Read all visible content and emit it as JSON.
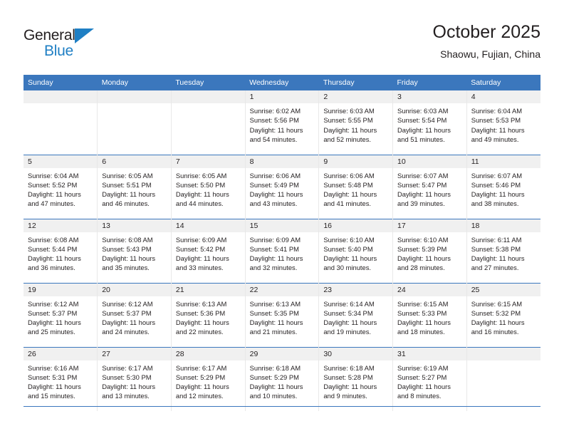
{
  "brand": {
    "name_part1": "General",
    "name_part2": "Blue",
    "triangle_color": "#1f7fc4",
    "text_color": "#231f20"
  },
  "header": {
    "title": "October 2025",
    "subtitle": "Shaowu, Fujian, China"
  },
  "theme": {
    "header_bg": "#3b77bd",
    "header_text": "#ffffff",
    "daynum_bg": "#f0f0f0",
    "cell_divider": "#e8e8e8",
    "row_divider": "#3b77bd",
    "body_text": "#231f20"
  },
  "weekday_headers": [
    "Sunday",
    "Monday",
    "Tuesday",
    "Wednesday",
    "Thursday",
    "Friday",
    "Saturday"
  ],
  "labels": {
    "sunrise_prefix": "Sunrise:",
    "sunset_prefix": "Sunset:",
    "daylight_prefix": "Daylight:"
  },
  "weeks": [
    [
      {
        "day": "",
        "line1": "",
        "line2": "",
        "line3": "",
        "line4": "",
        "empty": true
      },
      {
        "day": "",
        "line1": "",
        "line2": "",
        "line3": "",
        "line4": "",
        "empty": true
      },
      {
        "day": "",
        "line1": "",
        "line2": "",
        "line3": "",
        "line4": "",
        "empty": true
      },
      {
        "day": "1",
        "line1": "Sunrise: 6:02 AM",
        "line2": "Sunset: 5:56 PM",
        "line3": "Daylight: 11 hours",
        "line4": "and 54 minutes.",
        "empty": false
      },
      {
        "day": "2",
        "line1": "Sunrise: 6:03 AM",
        "line2": "Sunset: 5:55 PM",
        "line3": "Daylight: 11 hours",
        "line4": "and 52 minutes.",
        "empty": false
      },
      {
        "day": "3",
        "line1": "Sunrise: 6:03 AM",
        "line2": "Sunset: 5:54 PM",
        "line3": "Daylight: 11 hours",
        "line4": "and 51 minutes.",
        "empty": false
      },
      {
        "day": "4",
        "line1": "Sunrise: 6:04 AM",
        "line2": "Sunset: 5:53 PM",
        "line3": "Daylight: 11 hours",
        "line4": "and 49 minutes.",
        "empty": false
      }
    ],
    [
      {
        "day": "5",
        "line1": "Sunrise: 6:04 AM",
        "line2": "Sunset: 5:52 PM",
        "line3": "Daylight: 11 hours",
        "line4": "and 47 minutes.",
        "empty": false
      },
      {
        "day": "6",
        "line1": "Sunrise: 6:05 AM",
        "line2": "Sunset: 5:51 PM",
        "line3": "Daylight: 11 hours",
        "line4": "and 46 minutes.",
        "empty": false
      },
      {
        "day": "7",
        "line1": "Sunrise: 6:05 AM",
        "line2": "Sunset: 5:50 PM",
        "line3": "Daylight: 11 hours",
        "line4": "and 44 minutes.",
        "empty": false
      },
      {
        "day": "8",
        "line1": "Sunrise: 6:06 AM",
        "line2": "Sunset: 5:49 PM",
        "line3": "Daylight: 11 hours",
        "line4": "and 43 minutes.",
        "empty": false
      },
      {
        "day": "9",
        "line1": "Sunrise: 6:06 AM",
        "line2": "Sunset: 5:48 PM",
        "line3": "Daylight: 11 hours",
        "line4": "and 41 minutes.",
        "empty": false
      },
      {
        "day": "10",
        "line1": "Sunrise: 6:07 AM",
        "line2": "Sunset: 5:47 PM",
        "line3": "Daylight: 11 hours",
        "line4": "and 39 minutes.",
        "empty": false
      },
      {
        "day": "11",
        "line1": "Sunrise: 6:07 AM",
        "line2": "Sunset: 5:46 PM",
        "line3": "Daylight: 11 hours",
        "line4": "and 38 minutes.",
        "empty": false
      }
    ],
    [
      {
        "day": "12",
        "line1": "Sunrise: 6:08 AM",
        "line2": "Sunset: 5:44 PM",
        "line3": "Daylight: 11 hours",
        "line4": "and 36 minutes.",
        "empty": false
      },
      {
        "day": "13",
        "line1": "Sunrise: 6:08 AM",
        "line2": "Sunset: 5:43 PM",
        "line3": "Daylight: 11 hours",
        "line4": "and 35 minutes.",
        "empty": false
      },
      {
        "day": "14",
        "line1": "Sunrise: 6:09 AM",
        "line2": "Sunset: 5:42 PM",
        "line3": "Daylight: 11 hours",
        "line4": "and 33 minutes.",
        "empty": false
      },
      {
        "day": "15",
        "line1": "Sunrise: 6:09 AM",
        "line2": "Sunset: 5:41 PM",
        "line3": "Daylight: 11 hours",
        "line4": "and 32 minutes.",
        "empty": false
      },
      {
        "day": "16",
        "line1": "Sunrise: 6:10 AM",
        "line2": "Sunset: 5:40 PM",
        "line3": "Daylight: 11 hours",
        "line4": "and 30 minutes.",
        "empty": false
      },
      {
        "day": "17",
        "line1": "Sunrise: 6:10 AM",
        "line2": "Sunset: 5:39 PM",
        "line3": "Daylight: 11 hours",
        "line4": "and 28 minutes.",
        "empty": false
      },
      {
        "day": "18",
        "line1": "Sunrise: 6:11 AM",
        "line2": "Sunset: 5:38 PM",
        "line3": "Daylight: 11 hours",
        "line4": "and 27 minutes.",
        "empty": false
      }
    ],
    [
      {
        "day": "19",
        "line1": "Sunrise: 6:12 AM",
        "line2": "Sunset: 5:37 PM",
        "line3": "Daylight: 11 hours",
        "line4": "and 25 minutes.",
        "empty": false
      },
      {
        "day": "20",
        "line1": "Sunrise: 6:12 AM",
        "line2": "Sunset: 5:37 PM",
        "line3": "Daylight: 11 hours",
        "line4": "and 24 minutes.",
        "empty": false
      },
      {
        "day": "21",
        "line1": "Sunrise: 6:13 AM",
        "line2": "Sunset: 5:36 PM",
        "line3": "Daylight: 11 hours",
        "line4": "and 22 minutes.",
        "empty": false
      },
      {
        "day": "22",
        "line1": "Sunrise: 6:13 AM",
        "line2": "Sunset: 5:35 PM",
        "line3": "Daylight: 11 hours",
        "line4": "and 21 minutes.",
        "empty": false
      },
      {
        "day": "23",
        "line1": "Sunrise: 6:14 AM",
        "line2": "Sunset: 5:34 PM",
        "line3": "Daylight: 11 hours",
        "line4": "and 19 minutes.",
        "empty": false
      },
      {
        "day": "24",
        "line1": "Sunrise: 6:15 AM",
        "line2": "Sunset: 5:33 PM",
        "line3": "Daylight: 11 hours",
        "line4": "and 18 minutes.",
        "empty": false
      },
      {
        "day": "25",
        "line1": "Sunrise: 6:15 AM",
        "line2": "Sunset: 5:32 PM",
        "line3": "Daylight: 11 hours",
        "line4": "and 16 minutes.",
        "empty": false
      }
    ],
    [
      {
        "day": "26",
        "line1": "Sunrise: 6:16 AM",
        "line2": "Sunset: 5:31 PM",
        "line3": "Daylight: 11 hours",
        "line4": "and 15 minutes.",
        "empty": false
      },
      {
        "day": "27",
        "line1": "Sunrise: 6:17 AM",
        "line2": "Sunset: 5:30 PM",
        "line3": "Daylight: 11 hours",
        "line4": "and 13 minutes.",
        "empty": false
      },
      {
        "day": "28",
        "line1": "Sunrise: 6:17 AM",
        "line2": "Sunset: 5:29 PM",
        "line3": "Daylight: 11 hours",
        "line4": "and 12 minutes.",
        "empty": false
      },
      {
        "day": "29",
        "line1": "Sunrise: 6:18 AM",
        "line2": "Sunset: 5:29 PM",
        "line3": "Daylight: 11 hours",
        "line4": "and 10 minutes.",
        "empty": false
      },
      {
        "day": "30",
        "line1": "Sunrise: 6:18 AM",
        "line2": "Sunset: 5:28 PM",
        "line3": "Daylight: 11 hours",
        "line4": "and 9 minutes.",
        "empty": false
      },
      {
        "day": "31",
        "line1": "Sunrise: 6:19 AM",
        "line2": "Sunset: 5:27 PM",
        "line3": "Daylight: 11 hours",
        "line4": "and 8 minutes.",
        "empty": false
      },
      {
        "day": "",
        "line1": "",
        "line2": "",
        "line3": "",
        "line4": "",
        "empty": true
      }
    ]
  ]
}
